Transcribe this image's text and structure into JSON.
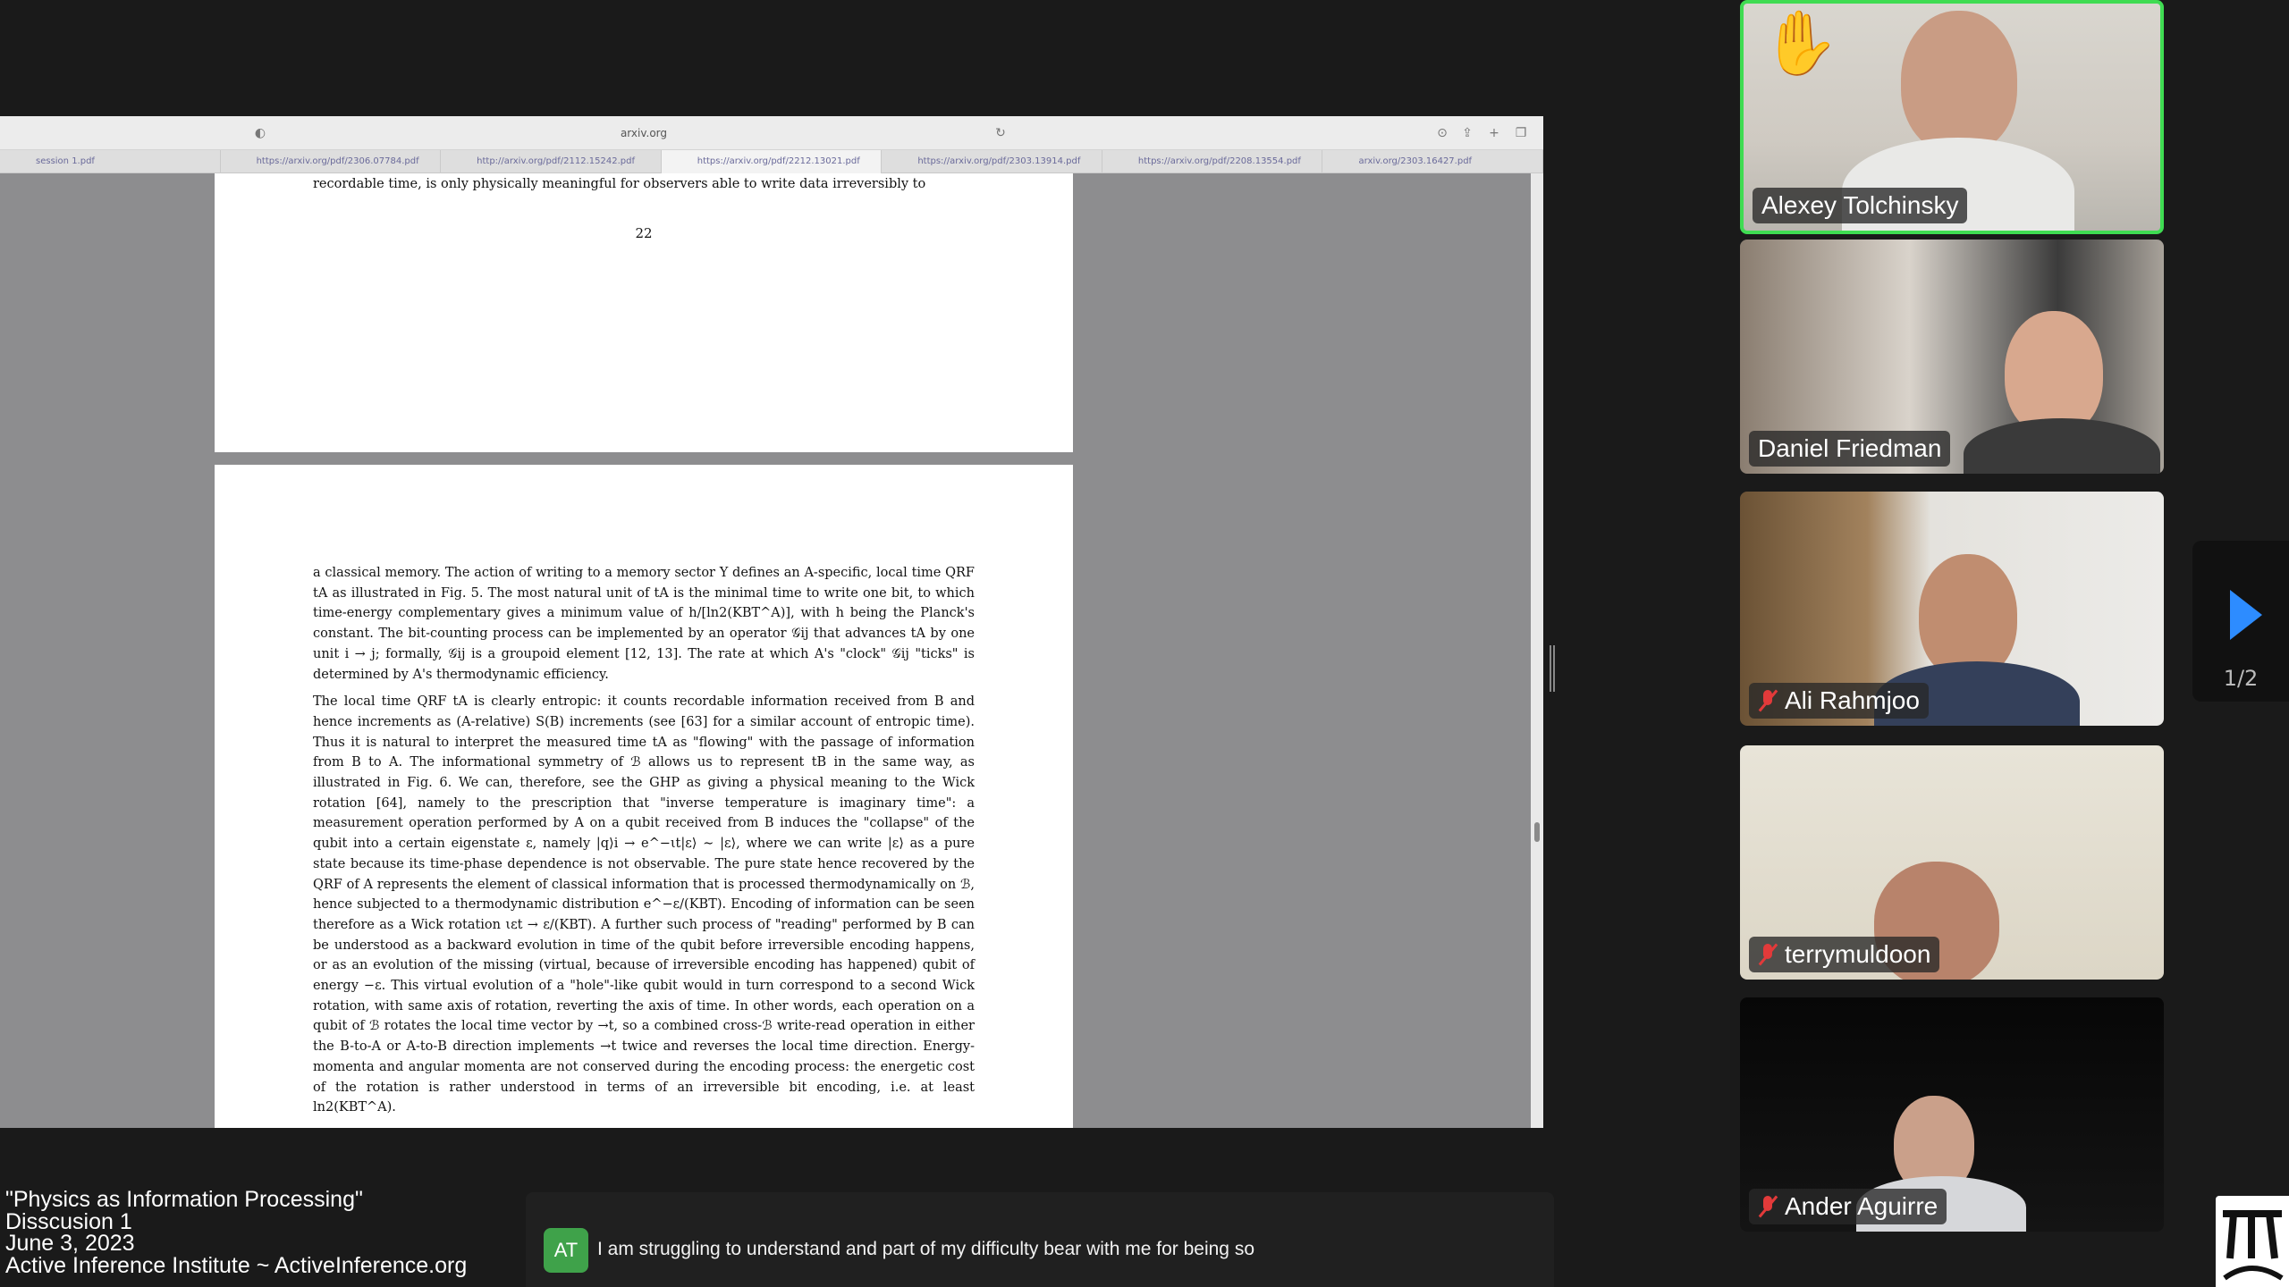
{
  "browser": {
    "url": "arxiv.org",
    "tabs": [
      "session 1.pdf",
      "https://arxiv.org/pdf/2306.07784.pdf",
      "http://arxiv.org/pdf/2112.15242.pdf",
      "https://arxiv.org/pdf/2212.13021.pdf",
      "https://arxiv.org/pdf/2303.13914.pdf",
      "https://arxiv.org/pdf/2208.13554.pdf",
      "arxiv.org/2303.16427.pdf"
    ],
    "active_tab": 3
  },
  "pdf": {
    "page1_line": "recordable time, is only physically meaningful for observers able to write data irreversibly to",
    "page_number": "22",
    "paragraph1": "a classical memory. The action of writing to a memory sector Y defines an A-specific, local time QRF tA as illustrated in Fig. 5. The most natural unit of tA is the minimal time to write one bit, to which time-energy complementary gives a minimum value of h/[ln2(KBT^A)], with h being the Planck's constant. The bit-counting process can be implemented by an operator 𝒢ij that advances tA by one unit i → j; formally, 𝒢ij is a groupoid element [12, 13]. The rate at which A's \"clock\" 𝒢ij \"ticks\" is determined by A's thermodynamic efficiency.",
    "paragraph2": "The local time QRF tA is clearly entropic: it counts recordable information received from B and hence increments as (A-relative) S(B) increments (see [63] for a similar account of entropic time). Thus it is natural to interpret the measured time tA as \"flowing\" with the passage of information from B to A. The informational symmetry of ℬ allows us to represent tB in the same way, as illustrated in Fig. 6. We can, therefore, see the GHP as giving a physical meaning to the Wick rotation [64], namely to the prescription that \"inverse temperature is imaginary time\": a measurement operation performed by A on a qubit received from B induces the \"collapse\" of the qubit into a certain eigenstate ε, namely |q⟩i → e^−ιt|ε⟩ ∼ |ε⟩, where we can write |ε⟩ as a pure state because its time-phase dependence is not observable. The pure state hence recovered by the QRF of A represents the element of classical information that is processed thermodynamically on ℬ, hence subjected to a thermodynamic distribution e^−ε/(KBT). Encoding of information can be seen therefore as a Wick rotation ιεt → ε/(KBT). A further such process of \"reading\" performed by B can be understood as a backward evolution in time of the qubit before irreversible encoding happens, or as an evolution of the missing (virtual, because of irreversible encoding has happened) qubit of energy −ε. This virtual evolution of a \"hole\"-like qubit would in turn correspond to a second Wick rotation, with same axis of rotation, reverting the axis of time. In other words, each operation on a qubit of ℬ rotates the local time vector by →t, so a combined cross-ℬ write-read operation in either the B-to-A or A-to-B direction implements →t twice and reverses the local time direction. Energy-momenta and angular momenta are not conserved during the encoding process: the energetic cost of the rotation is rather understood in terms of an irreversible bit encoding, i.e. at least ln2(KBT^A)."
  },
  "participants": [
    {
      "name": "Alexey Tolchinsky",
      "muted": false,
      "speaking": true,
      "hand_raised": true
    },
    {
      "name": "Daniel Friedman",
      "muted": false,
      "speaking": false,
      "hand_raised": false
    },
    {
      "name": "Ali Rahmjoo",
      "muted": true,
      "speaking": false,
      "hand_raised": false
    },
    {
      "name": "terrymuldoon",
      "muted": true,
      "speaking": false,
      "hand_raised": false
    },
    {
      "name": "Ander Aguirre",
      "muted": true,
      "speaking": false,
      "hand_raised": false
    }
  ],
  "pager": {
    "count": "1/2"
  },
  "caption": {
    "avatar_initials": "AT",
    "text": "I am struggling to understand and part of my difficulty bear with me for being so"
  },
  "overlay": {
    "line1": "\"Physics as Information Processing\"",
    "line2": "Disscusion 1",
    "line3": "June 3, 2023",
    "line4": "Active Inference Institute ~ ActiveInference.org"
  },
  "colors": {
    "speaking_border": "#3fdc52",
    "mute_red": "#e23a3a",
    "pager_arrow": "#2d8cff",
    "caption_avatar": "#3fa24a"
  }
}
